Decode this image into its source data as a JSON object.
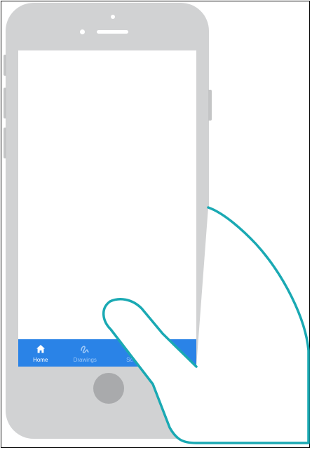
{
  "tabs": [
    {
      "label": "Home",
      "icon": "home-icon",
      "active": true
    },
    {
      "label": "Drawings",
      "icon": "squiggle-icon",
      "active": false
    },
    {
      "label": "Sc",
      "icon": "",
      "active": false
    },
    {
      "label": "",
      "icon": "person-icon",
      "active": false
    }
  ],
  "colors": {
    "tabbar": "#2a83e7",
    "phone_body": "#d1d2d3",
    "home_button": "#a9aaac",
    "hand_outline": "#1aa9b3"
  }
}
